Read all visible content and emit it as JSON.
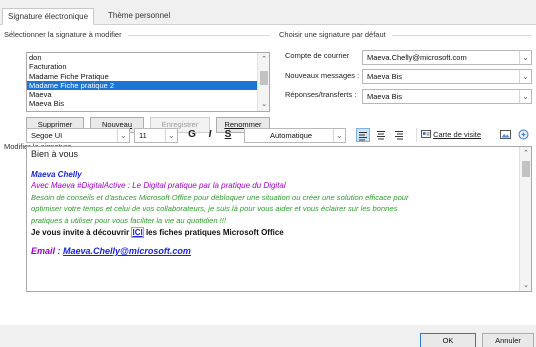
{
  "tabs": [
    "Signature électronique",
    "Thème personnel"
  ],
  "select_section": {
    "label": "Sélectionner la signature à modifier",
    "items": [
      "don",
      "Facturation",
      "Madame Fiche Pratique",
      "Madame Fiche pratique 2",
      "Maeva",
      "Maeva Bis"
    ],
    "selected_index": 3
  },
  "buttons": {
    "delete": "Supprimer",
    "new": "Nouveau",
    "save": "Enregistrer",
    "rename": "Renommer"
  },
  "default_section": {
    "label": "Choisir une signature par défaut",
    "account_label": "Compte de courrier",
    "account_value": "Maeva.Chelly@microsoft.com",
    "new_messages_label": "Nouveaux messages :",
    "new_messages_value": "Maeva Bis",
    "replies_label": "Réponses/transferts :",
    "replies_value": "Maeva Bis"
  },
  "edit_section": {
    "label": "Modifier la signature",
    "font": "Segoe UI",
    "size": "11",
    "bold": "G",
    "italic": "I",
    "underline": "S",
    "color": "Automatique",
    "business_card": "Carte de visite"
  },
  "signature": {
    "line1": "Bien à vous",
    "name": "Maeva Chelly",
    "tagline": "Avec Maeva #DigitalActive : Le Digital pratique par la pratique du Digital",
    "desc1": "Besoin de conseils et d'astuces Microsoft Office pour débloquer une situation ou créer une solution efficace pour",
    "desc2": "optimiser votre temps et celui de vos collaborateurs, je suis là pour vous aider et vous éclairer sur les bonnes",
    "desc3": "pratiques à utiliser pour vous faciliter la vie au quotidien !!!",
    "invite_before": "Je vous invite à découvrir ",
    "invite_link": "ICI",
    "invite_after": " les fiches pratiques Microsoft Office",
    "email_label": "Email : ",
    "email_value": "Maeva.Chelly@microsoft.com"
  },
  "footer": {
    "ok": "OK",
    "cancel": "Annuler"
  },
  "colors": {
    "selection": "#1c74d4",
    "name": "#1a24d8",
    "tagline": "#a300c8",
    "desc": "#2e9d2e",
    "link": "#1a24d8"
  }
}
